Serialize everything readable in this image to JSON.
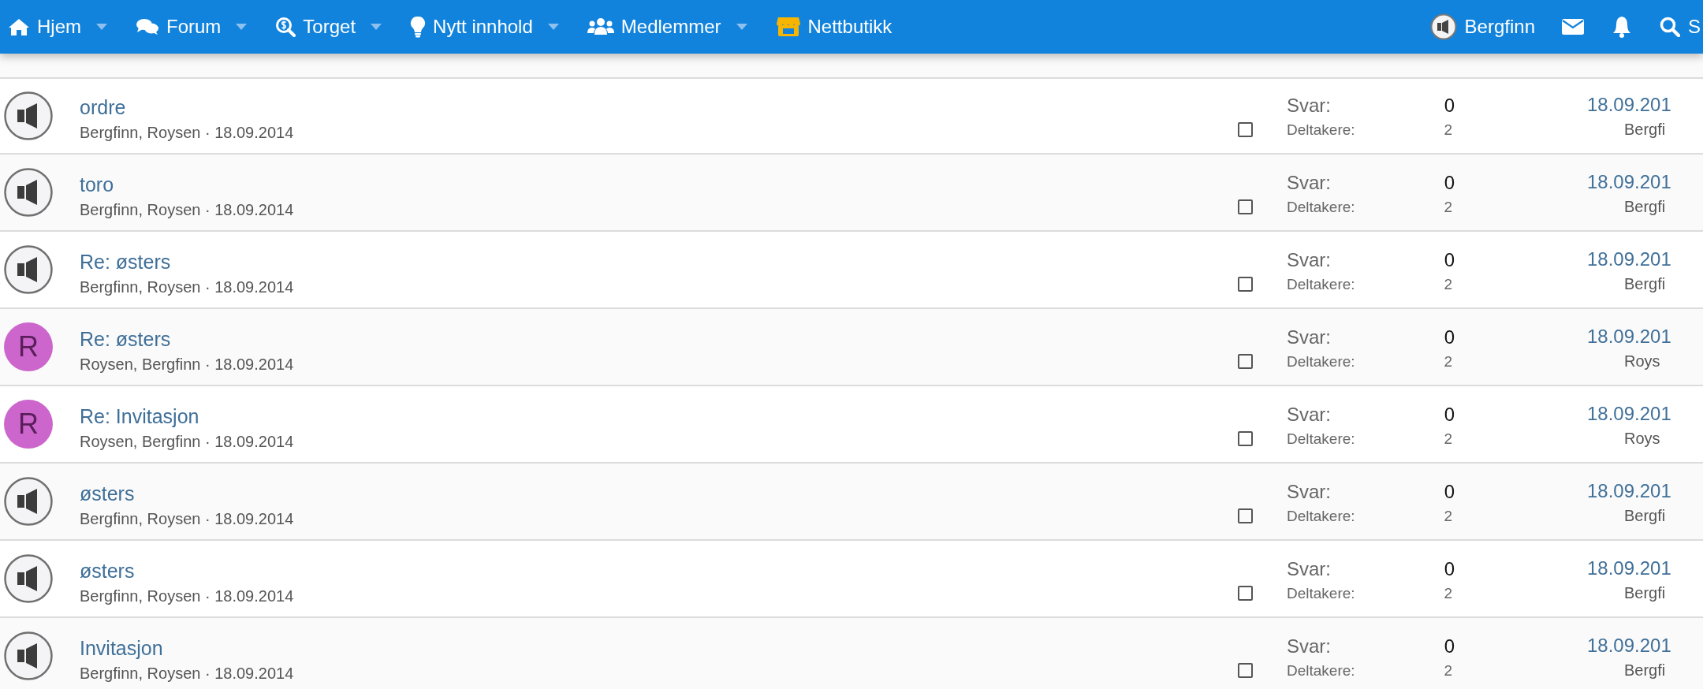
{
  "nav": {
    "items": [
      {
        "label": "Hjem",
        "has_menu": true
      },
      {
        "label": "Forum",
        "has_menu": true
      },
      {
        "label": "Torget",
        "has_menu": true
      },
      {
        "label": "Nytt innhold",
        "has_menu": true
      },
      {
        "label": "Medlemmer",
        "has_menu": true
      },
      {
        "label": "Nettbutikk",
        "has_menu": false
      }
    ],
    "user": {
      "name": "Bergfinn"
    },
    "search": {
      "label": "S"
    }
  },
  "conversations": [
    {
      "avatar": {
        "kind": "speaker"
      },
      "title": "ordre",
      "meta": "Bergfinn, Roysen · 18.09.2014",
      "checked": false,
      "replies_label": "Svar:",
      "replies": "0",
      "participants_label": "Deltakere:",
      "participants": "2",
      "last_date": "18.09.201",
      "last_user": "Bergfi"
    },
    {
      "avatar": {
        "kind": "speaker"
      },
      "title": "toro",
      "meta": "Bergfinn, Roysen · 18.09.2014",
      "checked": false,
      "replies_label": "Svar:",
      "replies": "0",
      "participants_label": "Deltakere:",
      "participants": "2",
      "last_date": "18.09.201",
      "last_user": "Bergfi"
    },
    {
      "avatar": {
        "kind": "speaker"
      },
      "title": "Re: østers",
      "meta": "Bergfinn, Roysen · 18.09.2014",
      "checked": false,
      "replies_label": "Svar:",
      "replies": "0",
      "participants_label": "Deltakere:",
      "participants": "2",
      "last_date": "18.09.201",
      "last_user": "Bergfi"
    },
    {
      "avatar": {
        "kind": "letter",
        "letter": "R",
        "color": "#cc66cc"
      },
      "title": "Re: østers",
      "meta": "Roysen, Bergfinn · 18.09.2014",
      "checked": false,
      "replies_label": "Svar:",
      "replies": "0",
      "participants_label": "Deltakere:",
      "participants": "2",
      "last_date": "18.09.201",
      "last_user": "Roys"
    },
    {
      "avatar": {
        "kind": "letter",
        "letter": "R",
        "color": "#cc66cc"
      },
      "title": "Re: Invitasjon",
      "meta": "Roysen, Bergfinn · 18.09.2014",
      "checked": false,
      "replies_label": "Svar:",
      "replies": "0",
      "participants_label": "Deltakere:",
      "participants": "2",
      "last_date": "18.09.201",
      "last_user": "Roys"
    },
    {
      "avatar": {
        "kind": "speaker"
      },
      "title": "østers",
      "meta": "Bergfinn, Roysen · 18.09.2014",
      "checked": false,
      "replies_label": "Svar:",
      "replies": "0",
      "participants_label": "Deltakere:",
      "participants": "2",
      "last_date": "18.09.201",
      "last_user": "Bergfi"
    },
    {
      "avatar": {
        "kind": "speaker"
      },
      "title": "østers",
      "meta": "Bergfinn, Roysen · 18.09.2014",
      "checked": false,
      "replies_label": "Svar:",
      "replies": "0",
      "participants_label": "Deltakere:",
      "participants": "2",
      "last_date": "18.09.201",
      "last_user": "Bergfi"
    },
    {
      "avatar": {
        "kind": "speaker"
      },
      "title": "Invitasjon",
      "meta": "Bergfinn, Roysen · 18.09.2014",
      "checked": false,
      "replies_label": "Svar:",
      "replies": "0",
      "participants_label": "Deltakere:",
      "participants": "2",
      "last_date": "18.09.201",
      "last_user": "Bergfi"
    }
  ]
}
